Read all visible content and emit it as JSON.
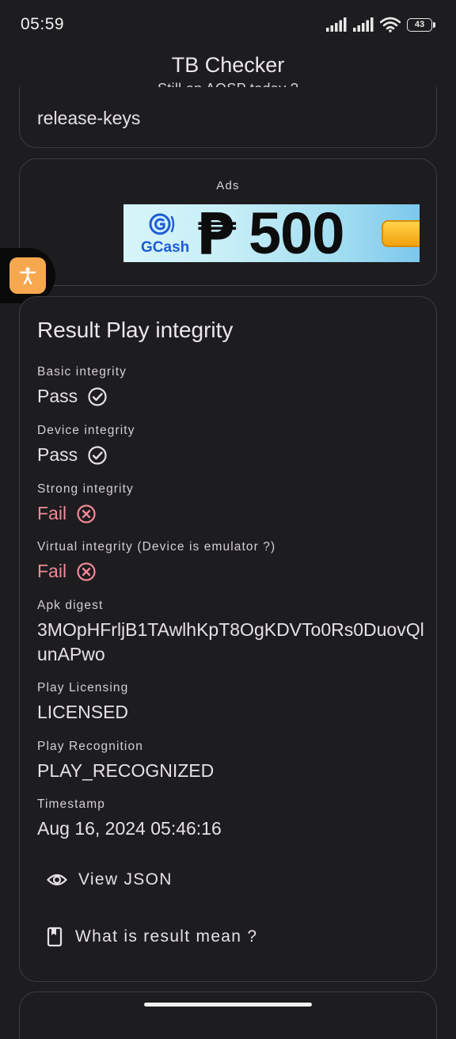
{
  "status_bar": {
    "time": "05:59",
    "battery_level": "43"
  },
  "header": {
    "title": "TB Checker",
    "subtitle": "Still on AOSP today ?"
  },
  "top_card": {
    "value": "release-keys"
  },
  "ads": {
    "label": "Ads",
    "banner": {
      "brand": "GCash",
      "currency_symbol": "₱",
      "amount": "500"
    }
  },
  "result": {
    "title": "Result Play integrity",
    "fields": [
      {
        "label": "Basic integrity",
        "value": "Pass",
        "status": "pass"
      },
      {
        "label": "Device integrity",
        "value": "Pass",
        "status": "pass"
      },
      {
        "label": "Strong integrity",
        "value": "Fail",
        "status": "fail"
      },
      {
        "label": "Virtual integrity (Device is emulator ?)",
        "value": "Fail",
        "status": "fail"
      },
      {
        "label": "Apk digest",
        "value": "3MOpHFrljB1TAwlhKpT8OgKDVTo0Rs0DuovQlunAPwo"
      },
      {
        "label": "Play Licensing",
        "value": "LICENSED"
      },
      {
        "label": "Play Recognition",
        "value": "PLAY_RECOGNIZED"
      },
      {
        "label": "Timestamp",
        "value": "Aug 16, 2024 05:46:16"
      }
    ],
    "actions": {
      "view_json": "View JSON",
      "what_is_result": "What is result mean ?"
    }
  },
  "colors": {
    "background": "#1d1c1f",
    "card_border": "#3e3c41",
    "fail": "#f08a98",
    "accessibility_button": "#f7a84f"
  }
}
